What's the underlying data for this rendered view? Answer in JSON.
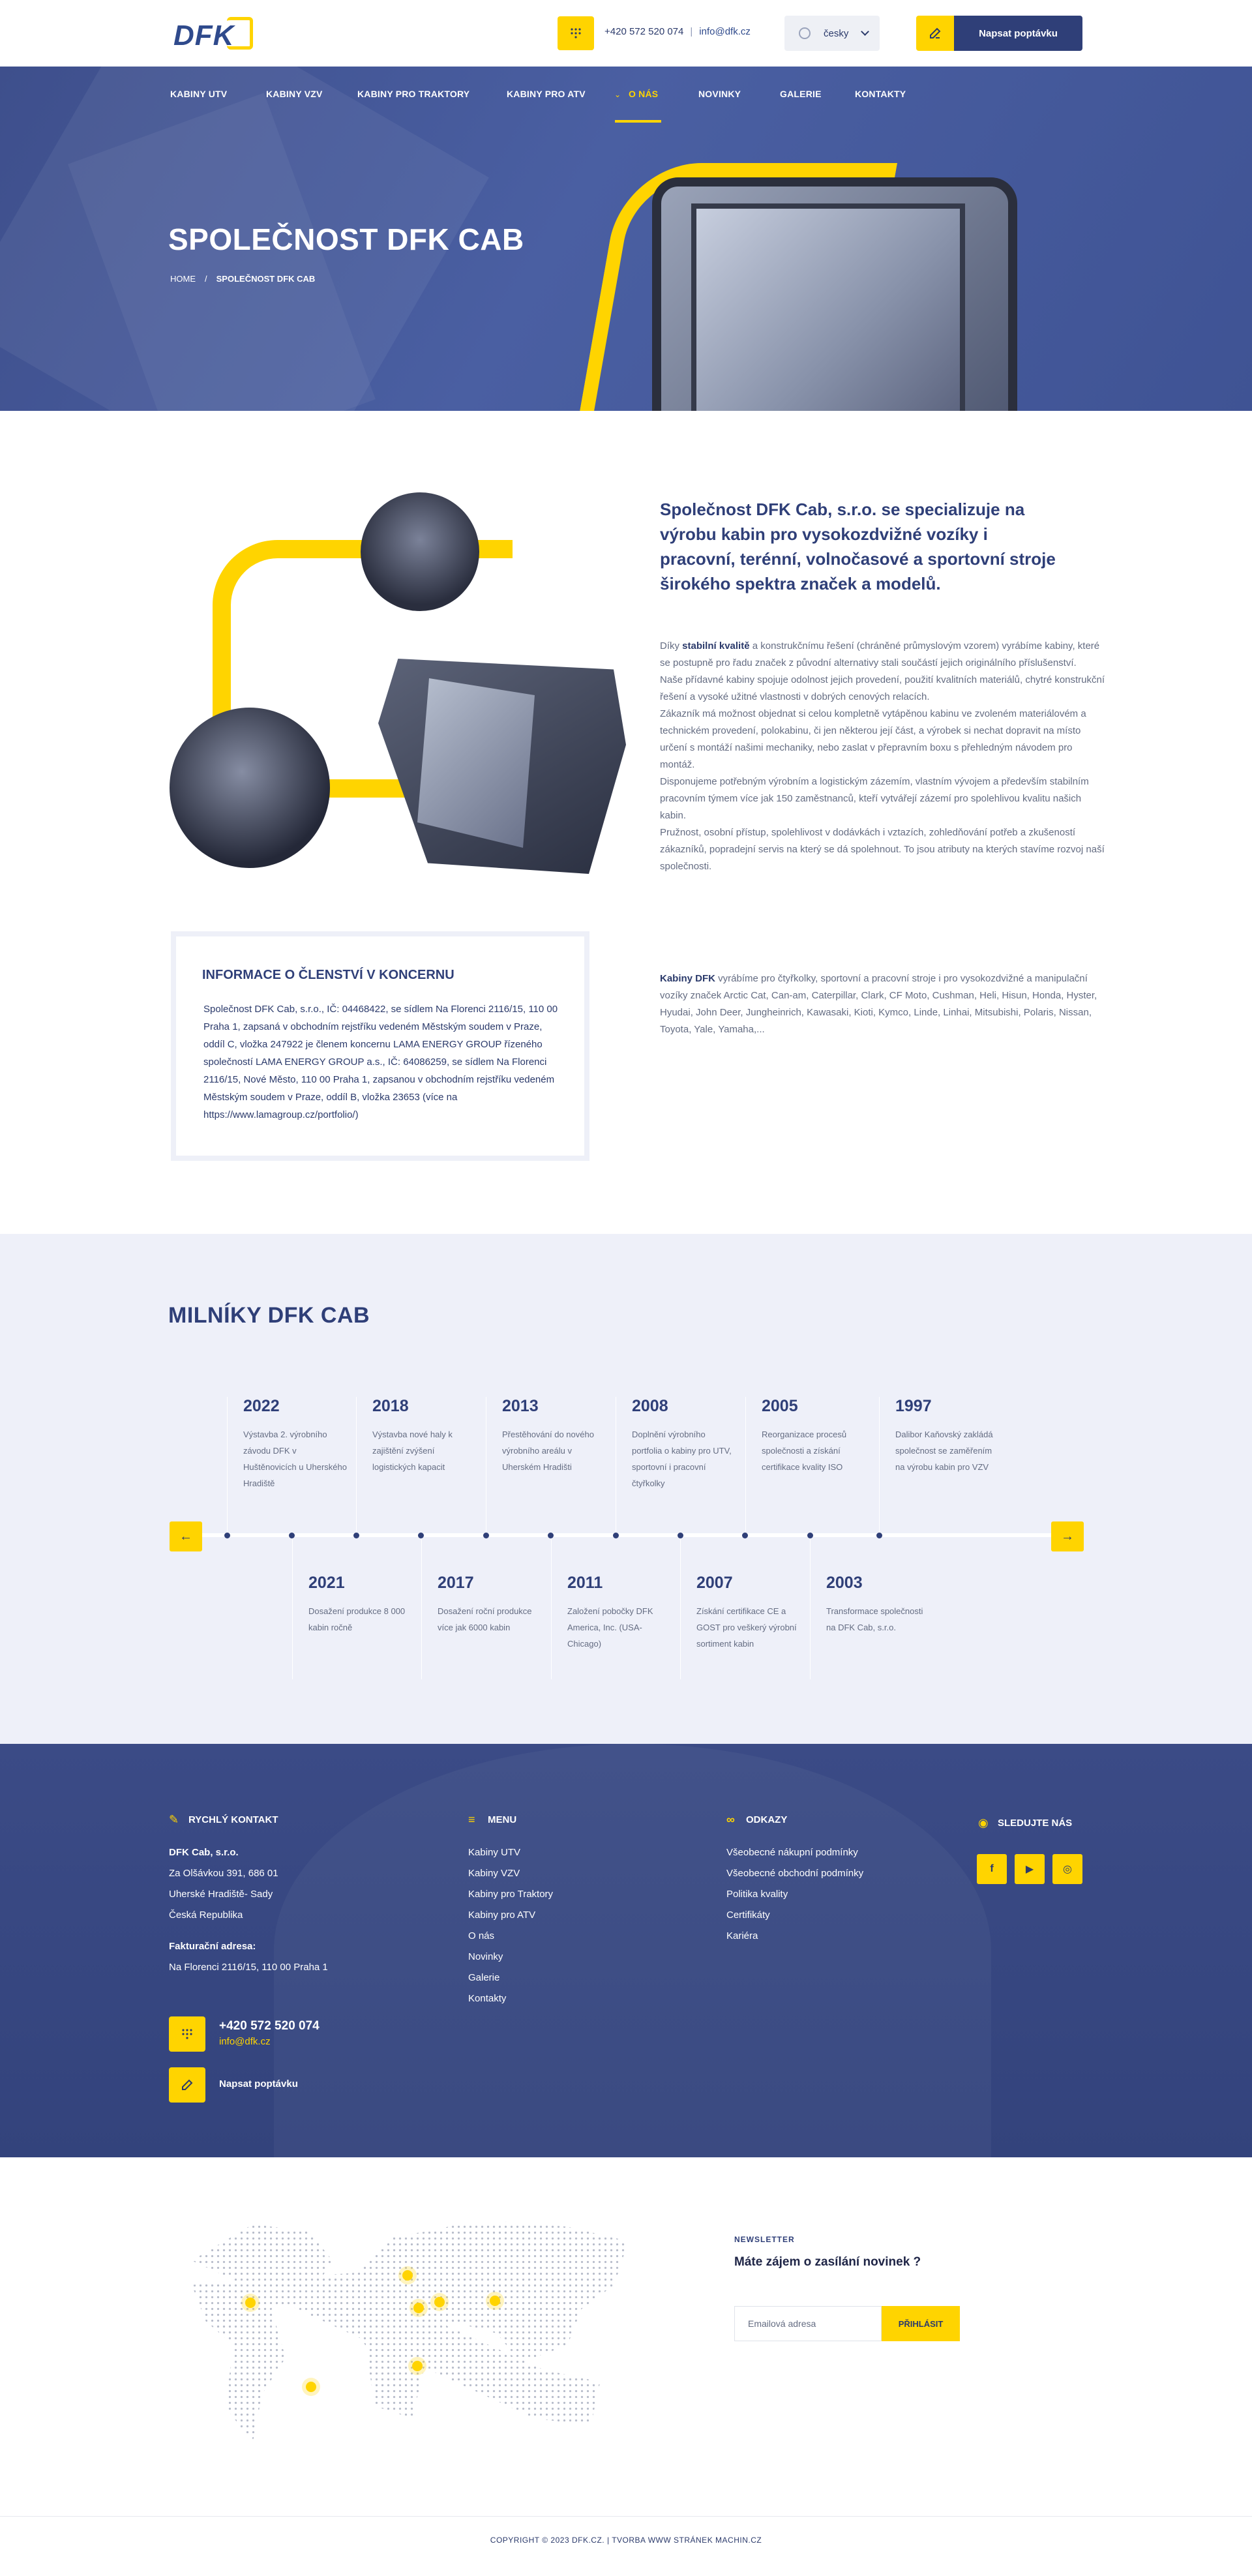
{
  "header": {
    "logo_text": "DFK",
    "phone": "+420 572 520 074",
    "email": "info@dfk.cz",
    "language": "česky",
    "request_button": "Napsat poptávku"
  },
  "nav": {
    "items": [
      {
        "label": "KABINY UTV"
      },
      {
        "label": "KABINY VZV"
      },
      {
        "label": "KABINY PRO TRAKTORY"
      },
      {
        "label": "KABINY PRO ATV"
      },
      {
        "label": "O NÁS"
      },
      {
        "label": "NOVINKY"
      },
      {
        "label": "GALERIE"
      },
      {
        "label": "KONTAKTY"
      }
    ]
  },
  "hero": {
    "title": "SPOLEČNOST DFK CAB",
    "breadcrumb_home": "HOME",
    "breadcrumb_sep": "/",
    "breadcrumb_current": "SPOLEČNOST DFK CAB"
  },
  "about": {
    "lead": "Společnost DFK Cab, s.r.o. se specializuje na výrobu kabin pro vysokozdvižné vozíky i pracovní, terénní, volnočasové a sportovní stroje širokého spektra značek a modelů.",
    "p1_prefix": "Díky ",
    "p1_bold": "stabilní kvalitě",
    "p1_rest": " a konstrukčnímu řešení (chráněné průmyslovým vzorem) vyrábíme kabiny, které se postupně pro řadu značek z původní alternativy stali součástí jejich originálního příslušenství.",
    "p2": "Naše přídavné kabiny spojuje odolnost jejich provedení, použití kvalitních materiálů, chytré konstrukční řešení a vysoké užitné vlastnosti v dobrých cenových relacích.",
    "p3": "Zákazník má možnost objednat si celou kompletně vytápěnou kabinu ve zvoleném materiálovém a technickém provedení, polokabinu, či jen některou její část, a výrobek si nechat dopravit na místo určení s montáží našimi mechaniky, nebo zaslat v přepravním boxu s přehledným návodem pro montáž.",
    "p4": "Disponujeme potřebným výrobním a logistickým zázemím, vlastním vývojem a především stabilním pracovním týmem více jak 150 zaměstnanců, kteří vytvářejí zázemí pro spolehlivou kvalitu našich kabin.",
    "p5": "Pružnost, osobní přístup, spolehlivost v dodávkách i vztazích, zohledňování potřeb a zkušeností zákazníků, popradejní servis na který se dá spolehnout. To jsou atributy na kterých stavíme rozvoj naší společnosti.",
    "brands_bold": "Kabiny DFK",
    "brands_rest": " vyrábíme pro čtyřkolky, sportovní a pracovní stroje i pro vysokozdvižné a manipulační vozíky značek Arctic Cat, Can-am, Caterpillar, Clark, CF Moto, Cushman, Heli, Hisun, Honda, Hyster, Hyudai, John Deer, Jungheinrich, Kawasaki, Kioti, Kymco, Linde, Linhai, Mitsubishi, Polaris, Nissan, Toyota, Yale, Yamaha,...",
    "info_title": "INFORMACE O ČLENSTVÍ V KONCERNU",
    "info_text": "Společnost DFK Cab, s.r.o., IČ: 04468422, se sídlem Na Florenci 2116/15, 110 00 Praha 1, zapsaná v obchodním rejstříku vedeném Městským soudem v Praze, oddíl C, vložka 247922 je členem koncernu LAMA ENERGY GROUP řízeného společností LAMA ENERGY GROUP a.s., IČ: 64086259, se sídlem Na Florenci 2116/15, Nové Město, 110 00 Praha 1, zapsanou v obchodním rejstříku vedeném Městským soudem v Praze, oddíl B, vložka 23653 (více na https://www.lamagroup.cz/portfolio/)"
  },
  "milestones": {
    "title": "MILNÍKY DFK CAB",
    "prev": "←",
    "next": "→",
    "top": [
      {
        "year": "2022",
        "text": "Výstavba 2. výrobního závodu DFK v Huštěnovicích u Uherského Hradiště"
      },
      {
        "year": "2018",
        "text": "Výstavba nové haly k zajištění zvýšení logistických kapacit"
      },
      {
        "year": "2013",
        "text": "Přestěhování do nového výrobního areálu v Uherském Hradišti"
      },
      {
        "year": "2008",
        "text": "Doplnění výrobního portfolia o kabiny pro UTV, sportovní i pracovní čtyřkolky"
      },
      {
        "year": "2005",
        "text": "Reorganizace procesů společnosti a získání certifikace kvality ISO"
      },
      {
        "year": "1997",
        "text": "Dalibor Kaňovský zakládá společnost se zaměřením na výrobu kabin pro VZV"
      }
    ],
    "bottom": [
      {
        "year": "2021",
        "text": "Dosažení produkce 8 000 kabin ročně"
      },
      {
        "year": "2017",
        "text": "Dosažení roční produkce více jak 6000 kabin"
      },
      {
        "year": "2011",
        "text": "Založení pobočky DFK America, Inc. (USA-Chicago)"
      },
      {
        "year": "2007",
        "text": "Získání certifikace CE a GOST pro veškerý výrobní sortiment kabin"
      },
      {
        "year": "2003",
        "text": "Transformace společnosti na DFK Cab, s.r.o."
      }
    ]
  },
  "footer": {
    "contact_title": "RYCHLÝ KONTAKT",
    "company": "DFK Cab, s.r.o.",
    "addr1": "Za Olšávkou 391, 686 01",
    "addr2": "Uherské Hradiště- Sady",
    "addr3": "Česká Republika",
    "billing_label": "Fakturační adresa:",
    "billing_addr": "Na Florenci 2116/15, 110 00 Praha 1",
    "phone": "+420 572 520 074",
    "email": "info@dfk.cz",
    "request": "Napsat poptávku",
    "menu_title": "MENU",
    "menu": [
      "Kabiny UTV",
      "Kabiny VZV",
      "Kabiny pro Traktory",
      "Kabiny pro ATV",
      "O nás",
      "Novinky",
      "Galerie",
      "Kontakty"
    ],
    "links_title": "ODKAZY",
    "links": [
      "Všeobecné nákupní podmínky",
      "Všeobecné obchodní podmínky",
      "Politika kvality",
      "Certifikáty",
      "Kariéra"
    ],
    "follow_title": "SLEDUJTE NÁS",
    "social": [
      "facebook-icon",
      "youtube-icon",
      "instagram-icon"
    ]
  },
  "newsletter": {
    "label": "NEWSLETTER",
    "question": "Máte zájem o zasílání novinek ?",
    "placeholder": "Emailová adresa",
    "button": "PŘIHLÁSIT"
  },
  "copyright": "COPYRIGHT © 2023 DFK.CZ.  |  TVORBA WWW STRÁNEK MACHIN.CZ",
  "colors": {
    "accent": "#ffd400",
    "primary": "#2f3f78"
  }
}
